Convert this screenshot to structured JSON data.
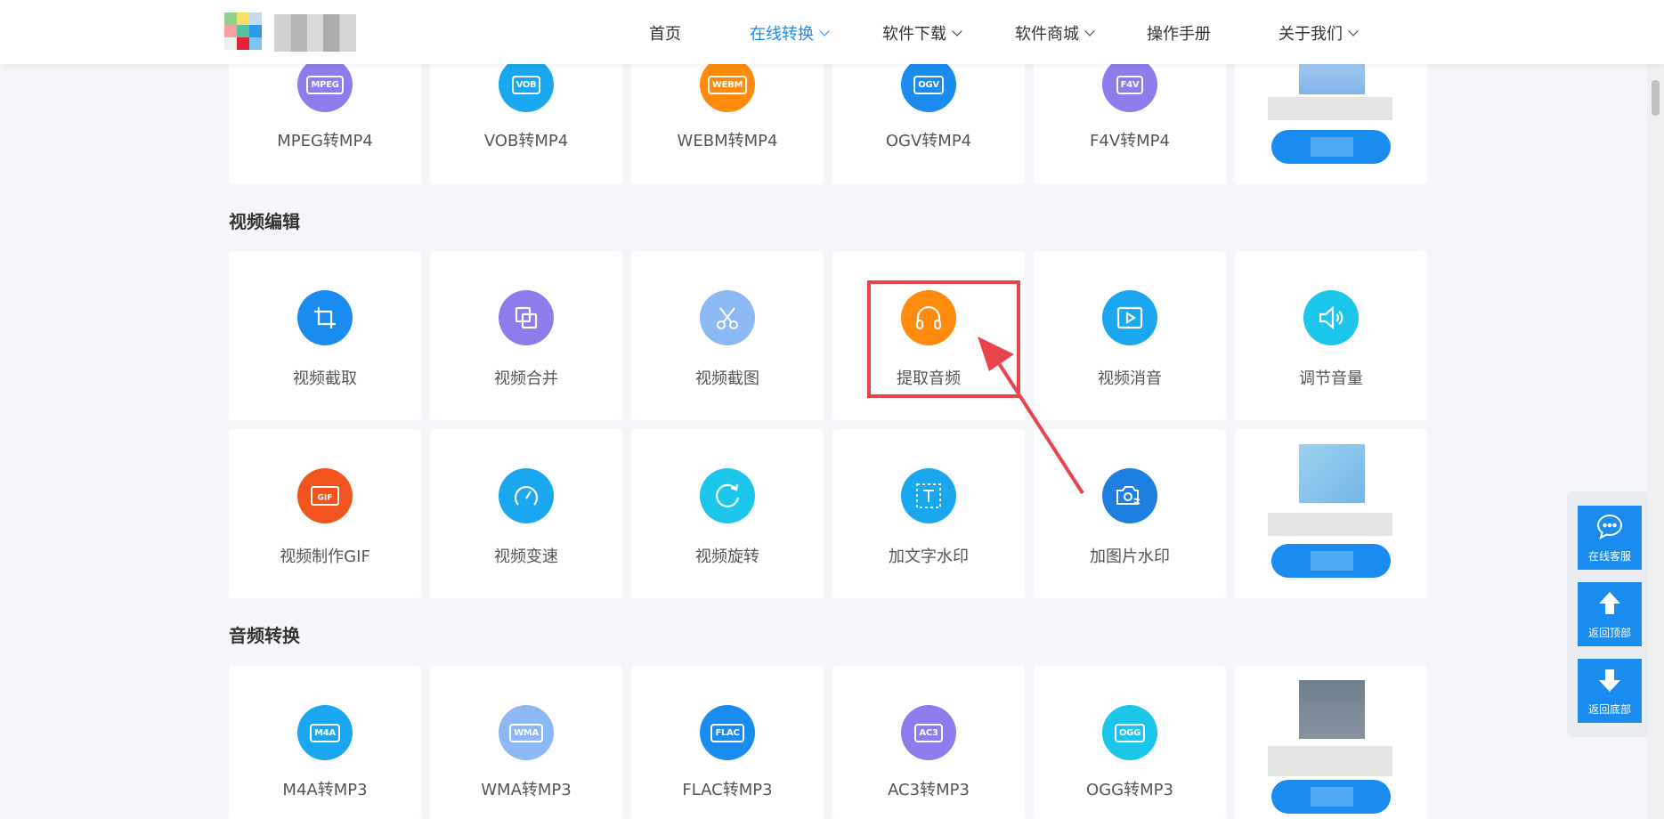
{
  "nav": {
    "items": [
      {
        "label": "首页",
        "has_dropdown": false,
        "active": false
      },
      {
        "label": "在线转换",
        "has_dropdown": true,
        "active": true
      },
      {
        "label": "软件下载",
        "has_dropdown": true,
        "active": false
      },
      {
        "label": "软件商城",
        "has_dropdown": true,
        "active": false
      },
      {
        "label": "操作手册",
        "has_dropdown": false,
        "active": false
      },
      {
        "label": "关于我们",
        "has_dropdown": true,
        "active": false
      }
    ]
  },
  "sections": {
    "video_convert": {
      "tools": [
        {
          "label": "MPEG转MP4",
          "badge": "MPEG",
          "color": "#8c7cec"
        },
        {
          "label": "VOB转MP4",
          "badge": "VOB",
          "color": "#1ba7ef"
        },
        {
          "label": "WEBM转MP4",
          "badge": "WEBM",
          "color": "#ff8a0c"
        },
        {
          "label": "OGV转MP4",
          "badge": "OGV",
          "color": "#1a8cf0"
        },
        {
          "label": "F4V转MP4",
          "badge": "F4V",
          "color": "#8c7cec"
        }
      ]
    },
    "video_edit": {
      "title": "视频编辑",
      "tools": [
        {
          "label": "视频截取",
          "icon": "crop-icon",
          "color": "#1a8cf0"
        },
        {
          "label": "视频合并",
          "icon": "merge-icon",
          "color": "#8c7cec"
        },
        {
          "label": "视频截图",
          "icon": "scissors-icon",
          "color": "#8cb8f4"
        },
        {
          "label": "提取音频",
          "icon": "headphones-icon",
          "color": "#ff8a0c"
        },
        {
          "label": "视频消音",
          "icon": "play-icon",
          "color": "#1ba7ef"
        },
        {
          "label": "调节音量",
          "icon": "speaker-icon",
          "color": "#1cc6ea"
        },
        {
          "label": "视频制作GIF",
          "icon": "gif-icon",
          "color": "#f2541d"
        },
        {
          "label": "视频变速",
          "icon": "speedometer-icon",
          "color": "#1ba7ef"
        },
        {
          "label": "视频旋转",
          "icon": "rotate-icon",
          "color": "#1cc6ea"
        },
        {
          "label": "加文字水印",
          "icon": "text-watermark-icon",
          "color": "#1ba7ef"
        },
        {
          "label": "加图片水印",
          "icon": "image-watermark-icon",
          "color": "#1f7fe0"
        }
      ]
    },
    "audio_convert": {
      "title": "音频转换",
      "tools": [
        {
          "label": "M4A转MP3",
          "badge": "M4A",
          "color": "#1ba7ef"
        },
        {
          "label": "WMA转MP3",
          "badge": "WMA",
          "color": "#8cb8f4"
        },
        {
          "label": "FLAC转MP3",
          "badge": "FLAC",
          "color": "#1a8cf0"
        },
        {
          "label": "AC3转MP3",
          "badge": "AC3",
          "color": "#8c7cec"
        },
        {
          "label": "OGG转MP3",
          "badge": "OGG",
          "color": "#1cc6ea"
        }
      ]
    }
  },
  "side_panel": {
    "chat_label": "在线客服",
    "top_label": "返回顶部",
    "bottom_label": "返回底部"
  },
  "colors": {
    "accent": "#1a8cf0",
    "highlight": "#e9444d",
    "background": "#f4f6f9"
  }
}
